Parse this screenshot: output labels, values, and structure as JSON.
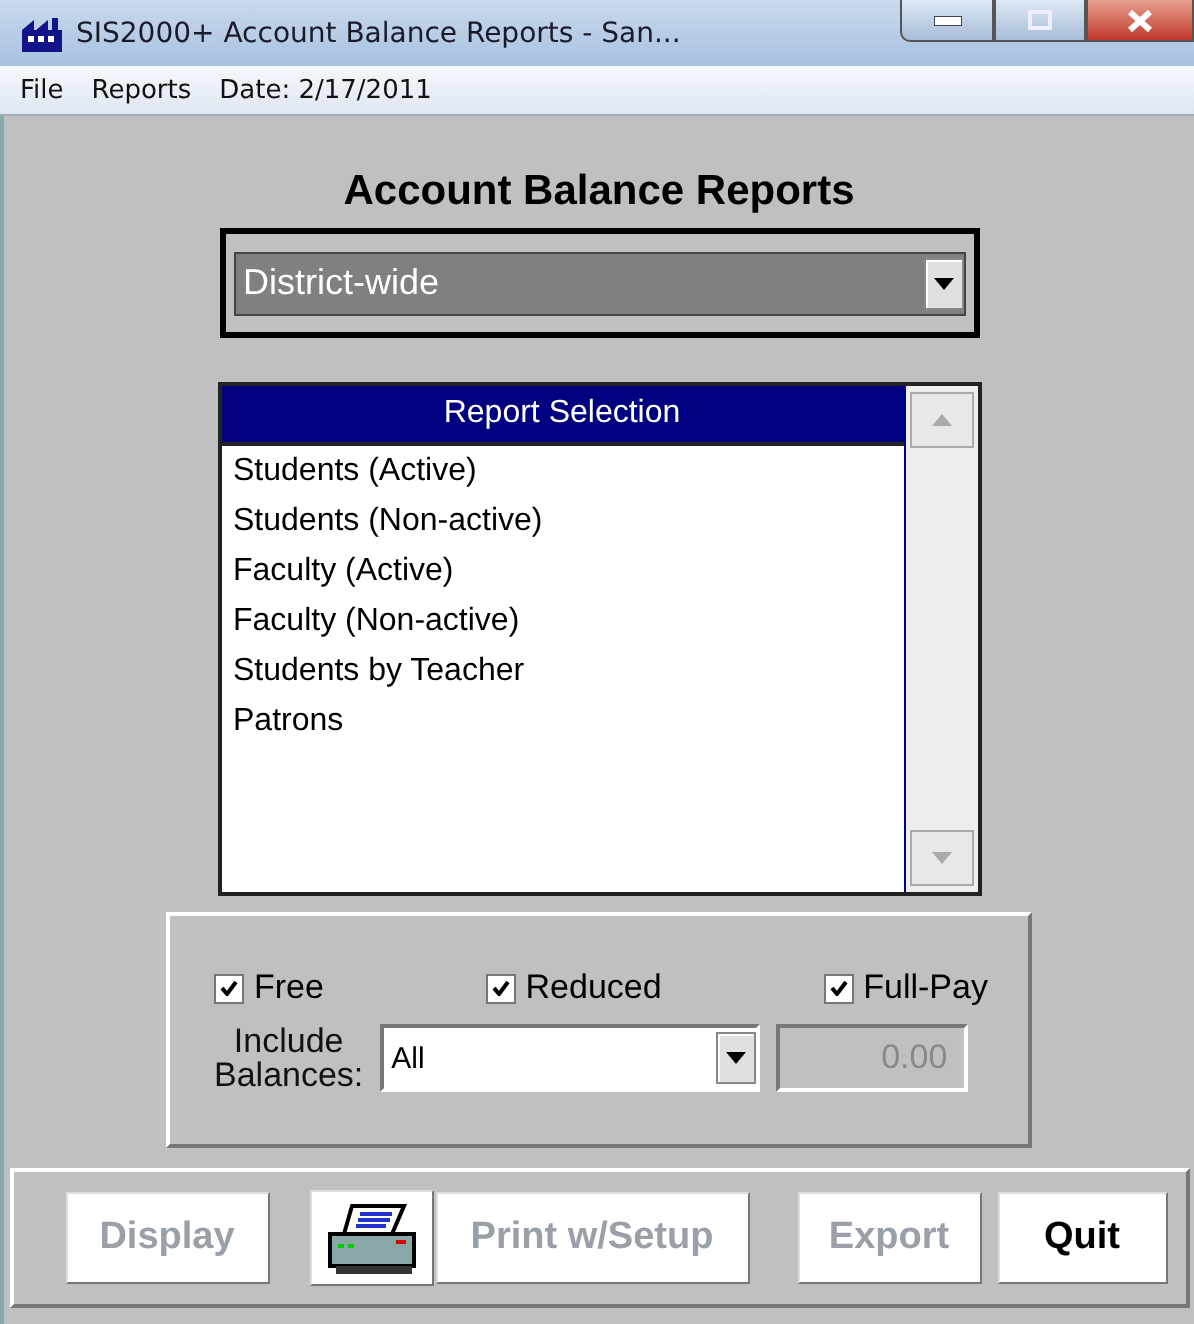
{
  "window": {
    "title": "SIS2000+ Account Balance Reports - San..."
  },
  "menu": [
    {
      "label": "File"
    },
    {
      "label": "Reports"
    },
    {
      "label": "Date: 2/17/2011"
    }
  ],
  "heading": "Account Balance Reports",
  "scope_dropdown": {
    "value": "District-wide"
  },
  "report_list": {
    "header": "Report Selection",
    "items": [
      {
        "label": "Students (Active)",
        "selected": false
      },
      {
        "label": "Students (Non-active)",
        "selected": false
      },
      {
        "label": "Faculty (Active)",
        "selected": false
      },
      {
        "label": "Faculty (Non-active)",
        "selected": false
      },
      {
        "label": "Students by Teacher",
        "selected": false
      },
      {
        "label": "Patrons",
        "selected": false
      }
    ]
  },
  "filters": [
    {
      "label": "Free",
      "checked": true
    },
    {
      "label": "Reduced",
      "checked": true
    },
    {
      "label": "Full-Pay",
      "checked": true
    }
  ],
  "include_balances": {
    "label_lines": [
      "Include",
      "Balances:"
    ],
    "value": "All",
    "amount": "0.00",
    "amount_disabled": true
  },
  "buttons": [
    {
      "label": "Display",
      "disabled": true,
      "kind": "text"
    },
    {
      "kind": "printer",
      "disabled": false
    },
    {
      "label": "Print w/Setup",
      "disabled": true,
      "kind": "text"
    },
    {
      "label": "Export",
      "disabled": true,
      "kind": "text"
    },
    {
      "label": "Quit",
      "disabled": false,
      "kind": "text"
    }
  ]
}
